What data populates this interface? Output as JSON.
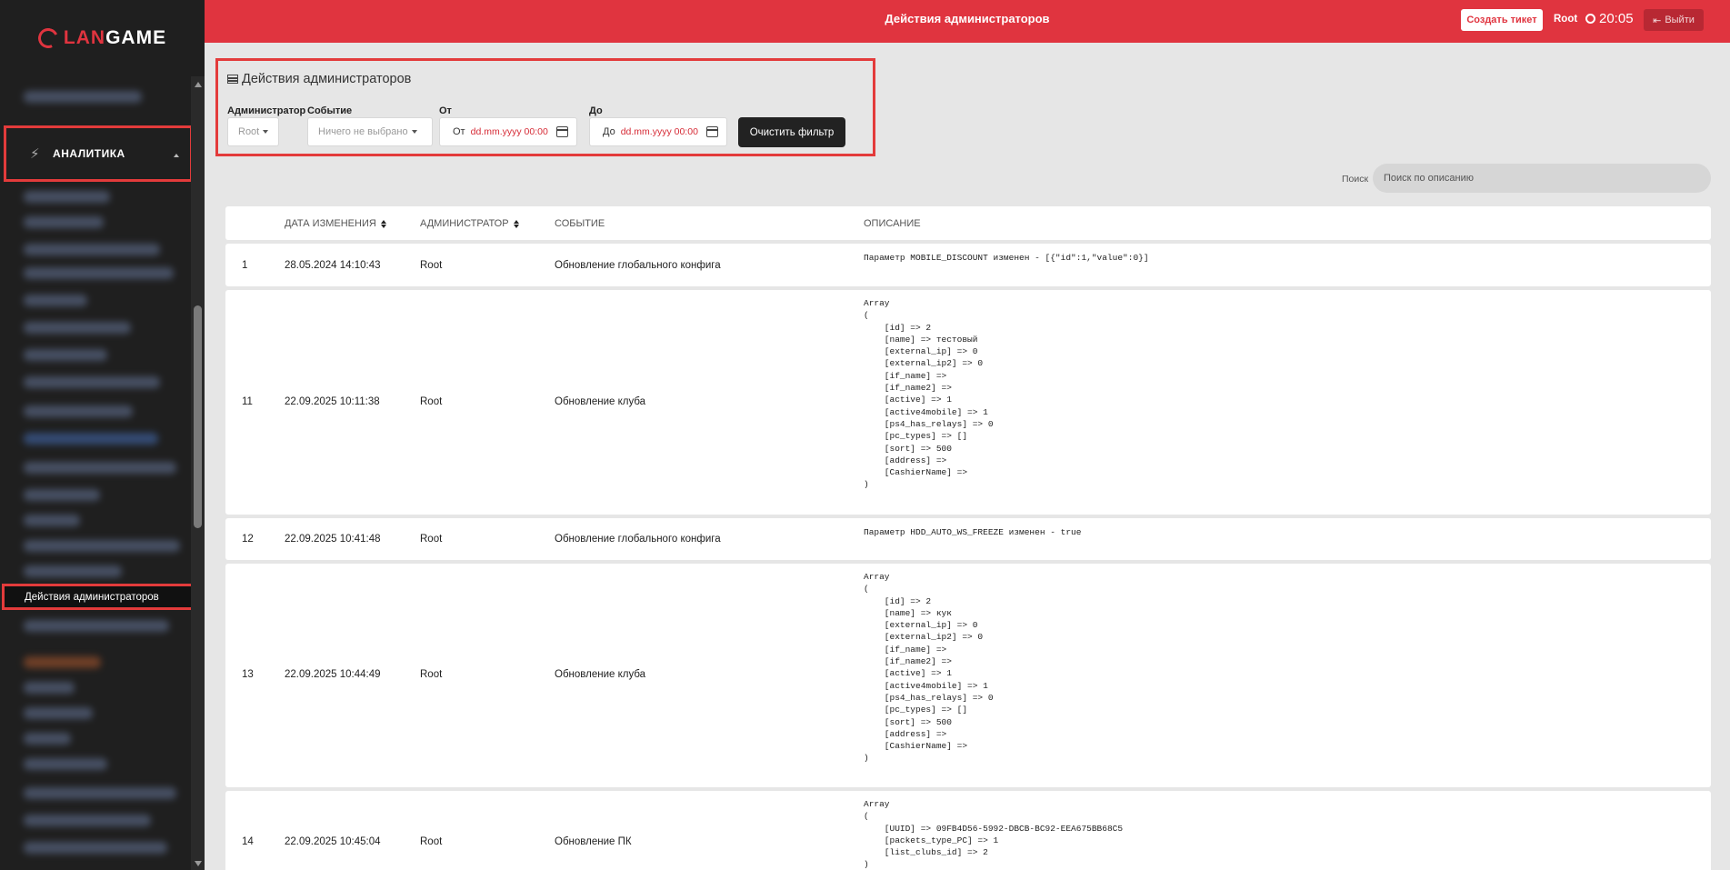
{
  "logo": {
    "prefix": "LAN",
    "suffix": "GAME"
  },
  "sidebar": {
    "analytics_label": "АНАЛИТИКА",
    "active_item_label": "Действия администраторов"
  },
  "header": {
    "title": "Действия администраторов",
    "ticket_button": "Создать тикет",
    "user": "Root",
    "time": "20:05",
    "logout_button": "Выйти"
  },
  "filter": {
    "title": "Действия администраторов",
    "admin_label": "Администратор",
    "admin_value": "Root",
    "event_label": "Событие",
    "event_placeholder": "Ничего не выбрано",
    "from_label": "От",
    "from_prefix": "От",
    "from_placeholder": "dd.mm.yyyy 00:00",
    "to_label": "До",
    "to_prefix": "До",
    "to_placeholder": "dd.mm.yyyy 00:00",
    "clear_button": "Очистить фильтр"
  },
  "search": {
    "label": "Поиск",
    "placeholder": "Поиск по описанию"
  },
  "table": {
    "columns": {
      "date": "Дата изменения",
      "admin": "Администратор",
      "event": "Событие",
      "desc": "Описание"
    },
    "rows": [
      {
        "num": "1",
        "date": "28.05.2024 14:10:43",
        "admin": "Root",
        "event": "Обновление глобального конфига",
        "desc": "Параметр MOBILE_DISCOUNT изменен - [{\"id\":1,\"value\":0}]"
      },
      {
        "num": "11",
        "date": "22.09.2025 10:11:38",
        "admin": "Root",
        "event": "Обновление клуба",
        "desc": "Array\n(\n    [id] => 2\n    [name] => тестовый\n    [external_ip] => 0\n    [external_ip2] => 0\n    [if_name] =>\n    [if_name2] =>\n    [active] => 1\n    [active4mobile] => 1\n    [ps4_has_relays] => 0\n    [pc_types] => []\n    [sort] => 500\n    [address] =>\n    [CashierName] =>\n)"
      },
      {
        "num": "12",
        "date": "22.09.2025 10:41:48",
        "admin": "Root",
        "event": "Обновление глобального конфига",
        "desc": "Параметр HDD_AUTO_WS_FREEZE изменен - true"
      },
      {
        "num": "13",
        "date": "22.09.2025 10:44:49",
        "admin": "Root",
        "event": "Обновление клуба",
        "desc": "Array\n(\n    [id] => 2\n    [name] => кук\n    [external_ip] => 0\n    [external_ip2] => 0\n    [if_name] =>\n    [if_name2] =>\n    [active] => 1\n    [active4mobile] => 1\n    [ps4_has_relays] => 0\n    [pc_types] => []\n    [sort] => 500\n    [address] =>\n    [CashierName] =>\n)"
      },
      {
        "num": "14",
        "date": "22.09.2025 10:45:04",
        "admin": "Root",
        "event": "Обновление ПК",
        "desc": "Array\n(\n    [UUID] => 09FB4D56-5992-DBCB-BC92-EEA675BB68C5\n    [packets_type_PC] => 1\n    [list_clubs_id] => 2\n)"
      }
    ]
  },
  "colors": {
    "accent": "#e0343f",
    "highlight_border": "#e33b3b",
    "sidebar_bg": "#1f1f1f",
    "page_bg": "#e6e6e6"
  }
}
